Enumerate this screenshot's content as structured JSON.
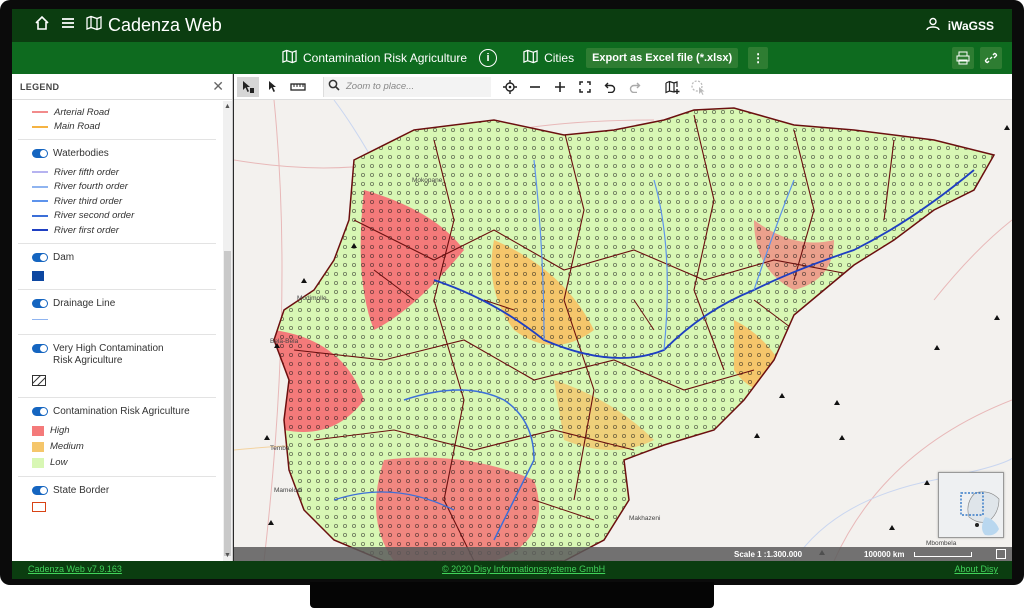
{
  "app": {
    "title": "Cadenza Web",
    "user": "iWaGSS"
  },
  "subbar": {
    "map_title": "Contamination Risk Agriculture",
    "cities_label": "Cities",
    "export_label": "Export as Excel file (*.xlsx)"
  },
  "legend": {
    "header": "LEGEND",
    "roads": [
      {
        "label": "Arterial Road",
        "color": "#f28b8b"
      },
      {
        "label": "Main Road",
        "color": "#f5b342"
      }
    ],
    "waterbodies": {
      "title": "Waterbodies",
      "items": [
        {
          "label": "River fifth order",
          "color": "#b6b3f0"
        },
        {
          "label": "River fourth order",
          "color": "#8fb4f0"
        },
        {
          "label": "River third order",
          "color": "#5d93ec"
        },
        {
          "label": "River second order",
          "color": "#3c6fd8"
        },
        {
          "label": "River first order",
          "color": "#1f3fc2"
        }
      ]
    },
    "dam": {
      "title": "Dam",
      "color": "#0d47a1"
    },
    "drainage": {
      "title": "Drainage Line",
      "color": "#8fb4f0"
    },
    "very_high": {
      "title": "Very High Contamination Risk Agriculture"
    },
    "contamination": {
      "title": "Contamination Risk Agriculture",
      "items": [
        {
          "label": "High",
          "color": "#f47a7a"
        },
        {
          "label": "Medium",
          "color": "#f5c66b"
        },
        {
          "label": "Low",
          "color": "#d8f7b4"
        }
      ]
    },
    "state_border": {
      "title": "State Border",
      "color": "#d84315"
    }
  },
  "toolbar": {
    "search_placeholder": "Zoom to place..."
  },
  "map": {
    "places": [
      "Mokopane",
      "Modimolle",
      "Bela-Bela",
      "Temba",
      "Mamelodi",
      "Mbombela",
      "Makhazeni"
    ],
    "scale_label": "Scale 1 :1.300.000",
    "distance_label": "100000 km"
  },
  "footer": {
    "version": "Cadenza Web v7.9.163",
    "copyright": "© 2020 Disy Informationssysteme GmbH",
    "about": "About Disy"
  }
}
